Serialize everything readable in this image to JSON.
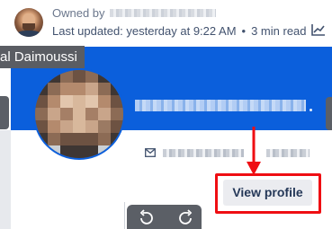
{
  "header": {
    "owned_by_label": "Owned by",
    "last_updated": "Last updated: yesterday at 9:22 AM",
    "separator": "•",
    "read_time": "3 min read"
  },
  "profile_card": {
    "name_fragment": "al Daimoussi",
    "view_profile_label": "View profile",
    "banner_color": "#0b5fdc"
  },
  "annotation": {
    "highlight_color": "#ef0e13"
  },
  "icons": {
    "analytics": "analytics-chart-icon",
    "mail": "mail-icon",
    "undo": "rotate-left-icon",
    "redo": "rotate-right-icon"
  }
}
